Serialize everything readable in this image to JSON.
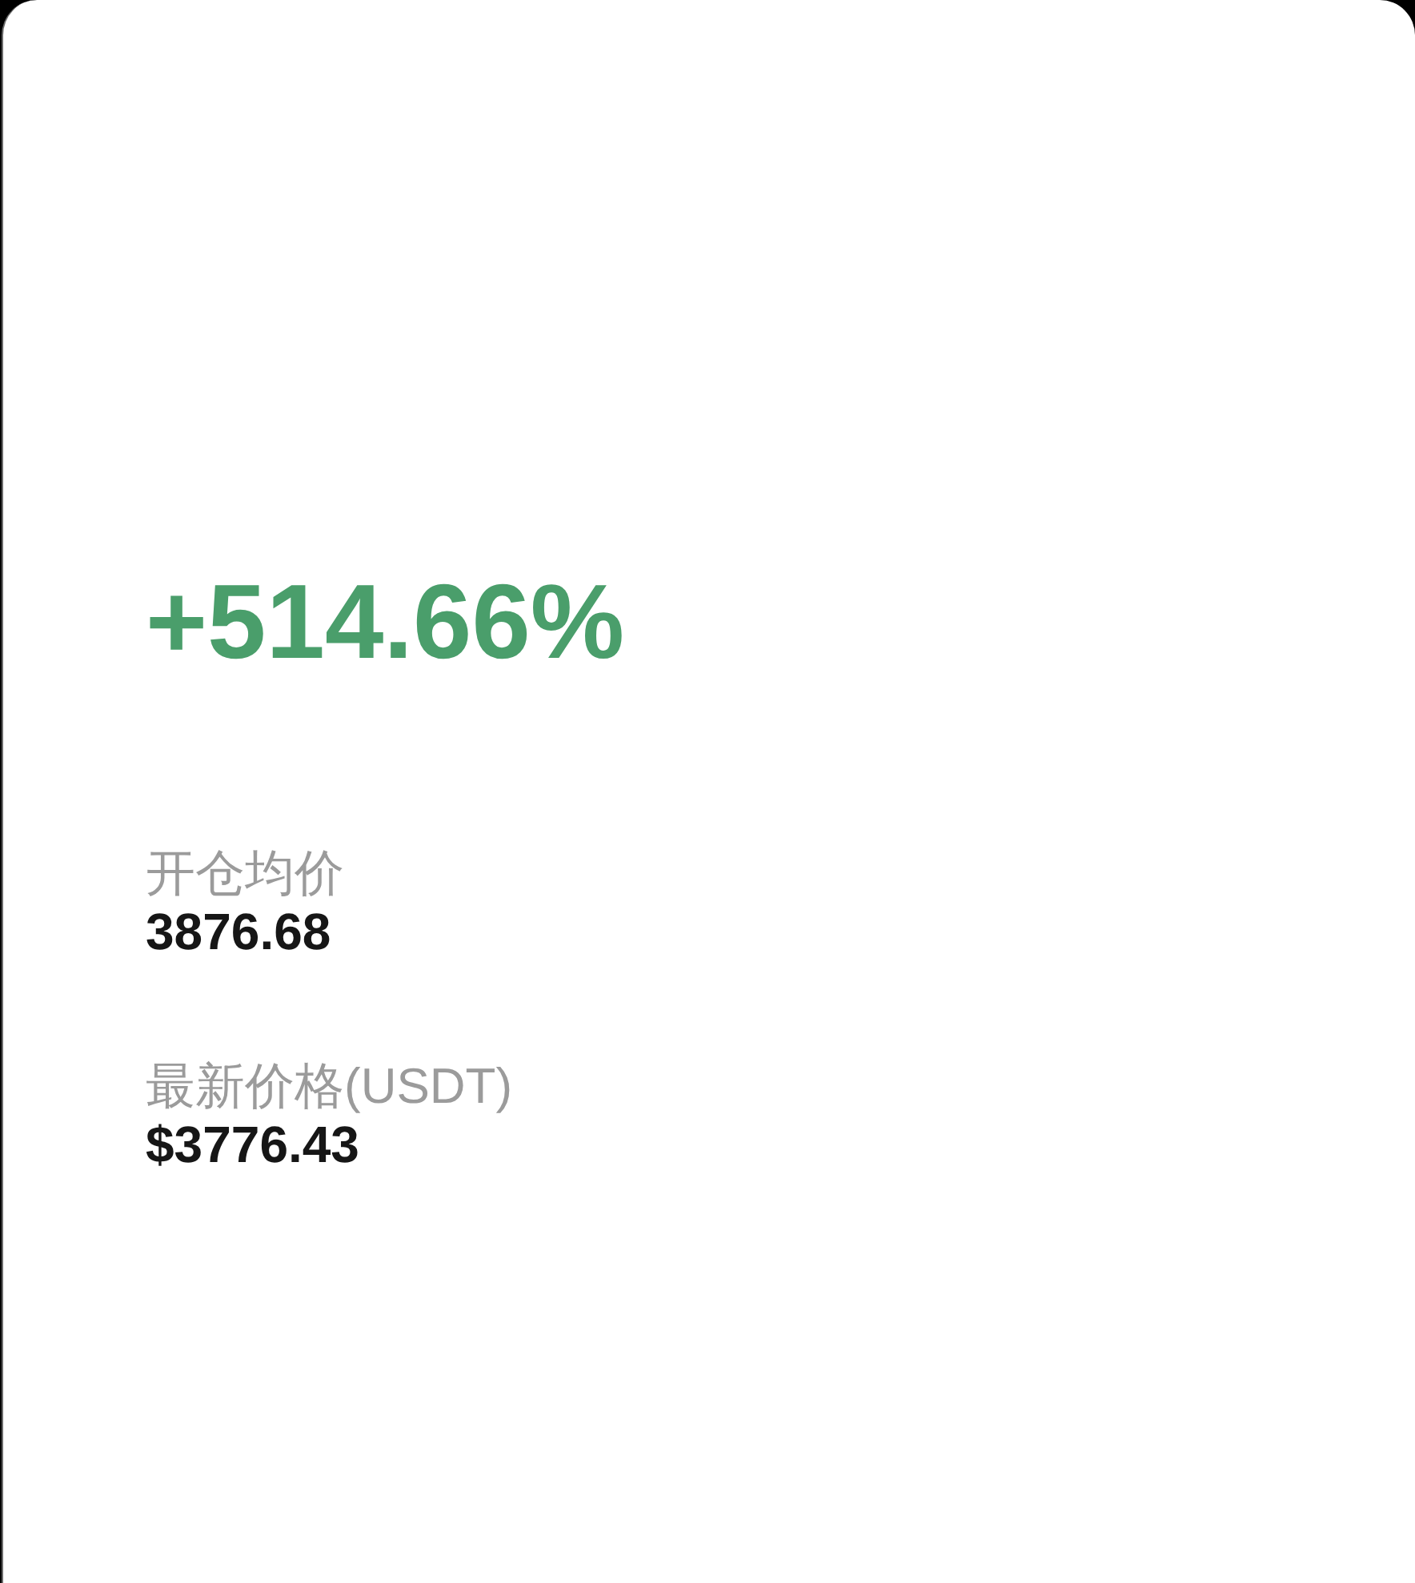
{
  "pnl": {
    "percent": "+514.66%"
  },
  "fields": [
    {
      "label": "开仓均价",
      "value": "3876.68"
    },
    {
      "label": "最新价格(USDT)",
      "value": "$3776.43"
    }
  ]
}
